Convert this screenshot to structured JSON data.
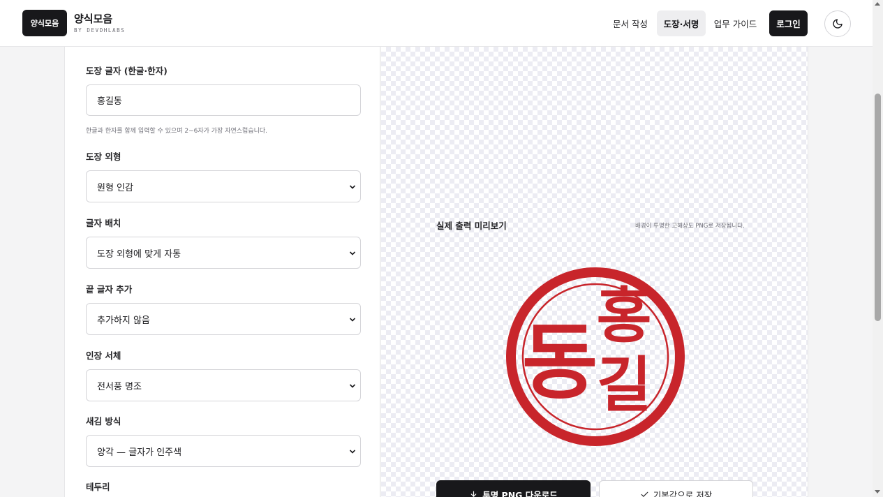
{
  "header": {
    "logo_label": "양식모음",
    "brand_title": "양식모음",
    "brand_sub": "BY DEVDHLABS",
    "nav": [
      "문서 작성",
      "도장·서명",
      "업무 가이드"
    ],
    "login_label": "로그인",
    "theme_icon": "moon-icon"
  },
  "form": {
    "stamp_text": {
      "label": "도장 글자 (한글·한자)",
      "value": "홍길동",
      "hint": "한글과 한자를 함께 입력할 수 있으며 2~6자가 가장 자연스럽습니다."
    },
    "shape": {
      "label": "도장 외형",
      "value": "원형 인감"
    },
    "layout": {
      "label": "글자 배치",
      "value": "도장 외형에 맞게 자동"
    },
    "suffix": {
      "label": "끝 글자 추가",
      "value": "추가하지 않음"
    },
    "font": {
      "label": "인장 서체",
      "value": "전서풍 명조"
    },
    "engrave": {
      "label": "새김 방식",
      "value": "양각 — 글자가 인주색"
    },
    "border": {
      "label": "테두리"
    }
  },
  "preview": {
    "title": "실제 출력 미리보기",
    "note": "배경이 투명한 고해상도 PNG로 저장됩니다.",
    "stamp_chars": [
      "홍",
      "길",
      "동"
    ],
    "stamp_color": "#c8252b",
    "download_label": "투명 PNG 다운로드",
    "save_label": "기본값으로 저장"
  }
}
